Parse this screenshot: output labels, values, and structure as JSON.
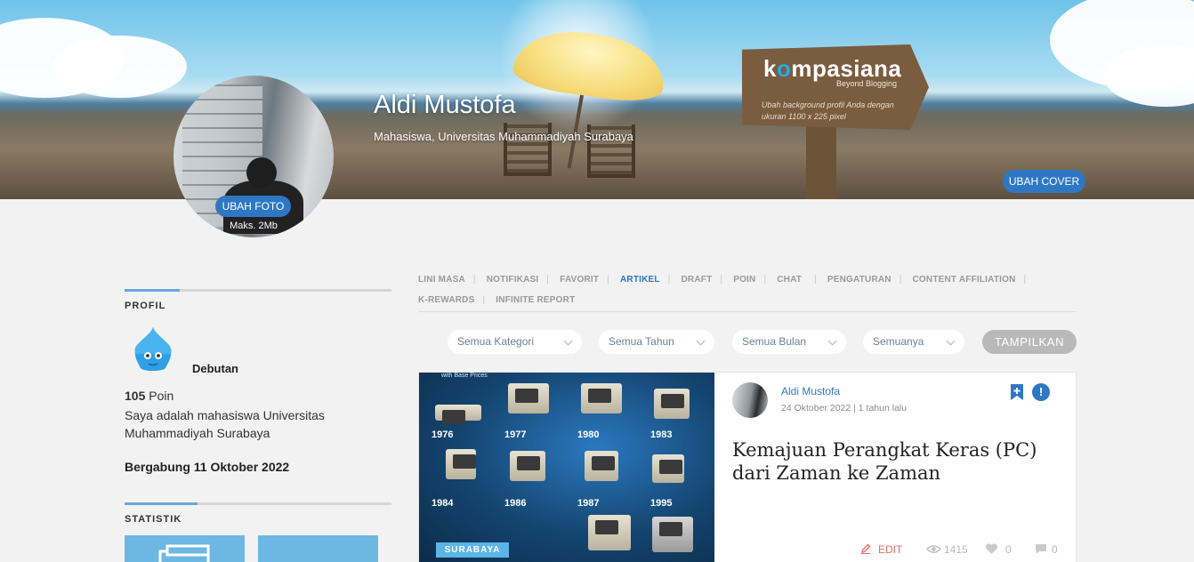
{
  "cover": {
    "brand": {
      "logo_pre": "k",
      "logo_o": "o",
      "logo_post": "mpasiana",
      "tagline": "Beyond Blogging"
    },
    "sign_note": "Ubah background profil Anda dengan ukuran 1100 x 225 pixel",
    "change_cover_label": "UBAH COVER"
  },
  "profile": {
    "name": "Aldi Mustofa",
    "subtitle": "Mahasiswa, Universitas Muhammadiyah Surabaya",
    "change_photo_label": "UBAH FOTO",
    "photo_max": "Maks. 2Mb"
  },
  "sidebar": {
    "profile_title": "PROFIL",
    "rank": "Debutan",
    "points_value": "105",
    "points_label": "Poin",
    "bio": "Saya adalah mahasiswa Universitas Muhammadiyah Surabaya",
    "joined": "Bergabung 11 Oktober 2022",
    "stats_title": "STATISTIK"
  },
  "nav": {
    "items": [
      {
        "label": "LINI MASA"
      },
      {
        "label": "NOTIFIKASI"
      },
      {
        "label": "FAVORIT"
      },
      {
        "label": "ARTIKEL",
        "active": true
      },
      {
        "label": "DRAFT"
      },
      {
        "label": "POIN"
      },
      {
        "label": "CHAT"
      },
      {
        "label": "PENGATURAN"
      },
      {
        "label": "CONTENT AFFILIATION"
      },
      {
        "label": "K-REWARDS"
      },
      {
        "label": "INFINITE REPORT"
      }
    ]
  },
  "filters": {
    "category": "Semua Kategori",
    "year": "Semua Tahun",
    "month": "Semua Bulan",
    "type": "Semuanya",
    "show_label": "TAMPILKAN"
  },
  "article": {
    "thumb_caption": "with Base Prices",
    "years": [
      "1976",
      "1977",
      "1980",
      "1983",
      "1984",
      "1986",
      "1987",
      "1995"
    ],
    "category_badge": "SURABAYA",
    "author": "Aldi Mustofa",
    "date": "24 Oktober 2022 | 1 tahun lalu",
    "title": "Kemajuan Perangkat Keras (PC) dari Zaman ke Zaman",
    "edit_label": "EDIT",
    "views": "1415",
    "likes": "0",
    "comments": "0"
  },
  "colors": {
    "accent": "#2e77c4",
    "stat_box": "#6cb8e2",
    "edit": "#e06a6a"
  }
}
